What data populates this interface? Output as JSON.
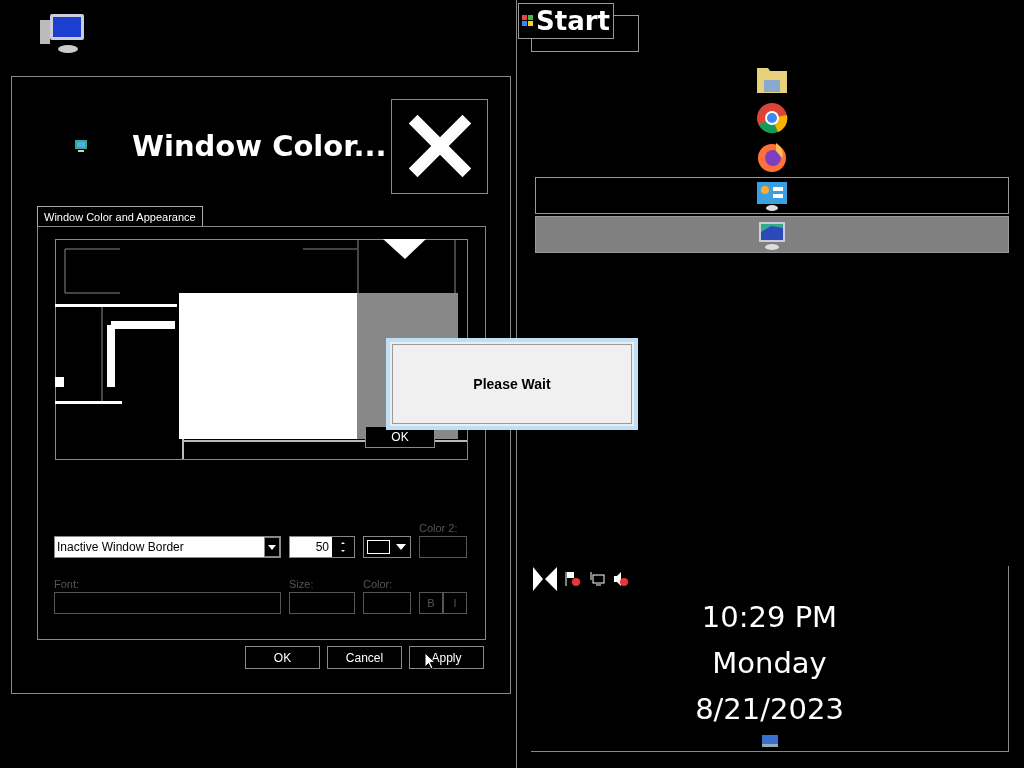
{
  "dialog": {
    "title": "Window Color...",
    "tabs": [
      {
        "label": "Window Color and Appearance",
        "selected": true
      }
    ],
    "preview": {
      "button_label": "OK"
    },
    "item": {
      "value": "Inactive Window Border"
    },
    "size": {
      "value": "50"
    },
    "color2": {
      "label": "Color 2:",
      "disabled": true
    },
    "font": {
      "label": "Font:",
      "disabled": true
    },
    "font_size": {
      "label": "Size:",
      "disabled": true
    },
    "font_color": {
      "label": "Color:",
      "disabled": true
    },
    "style_buttons": [
      {
        "label": "B",
        "disabled": true
      },
      {
        "label": "I",
        "disabled": true
      }
    ],
    "buttons": [
      "OK",
      "Cancel",
      "Apply"
    ]
  },
  "message_box": {
    "text": "Please Wait"
  },
  "taskbar": {
    "start_buttons": [
      "Start"
    ],
    "items": [
      {
        "kind": "folder",
        "running": false,
        "selected": false
      },
      {
        "kind": "chrome",
        "running": false,
        "selected": false
      },
      {
        "kind": "firefox",
        "running": false,
        "selected": false
      },
      {
        "kind": "control-panel",
        "running": true,
        "selected": false
      },
      {
        "kind": "display",
        "running": true,
        "selected": true
      }
    ],
    "clock": {
      "time": "10:29 PM",
      "day": "Monday",
      "date": "8/21/2023"
    }
  }
}
